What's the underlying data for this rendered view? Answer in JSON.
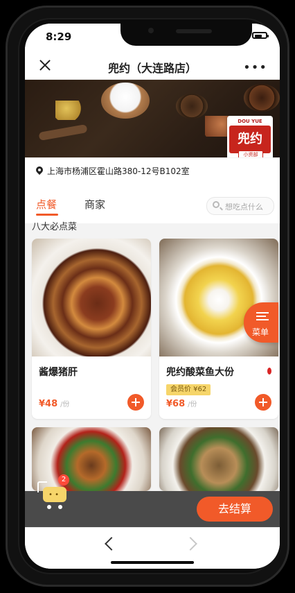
{
  "status": {
    "time": "8:29"
  },
  "nav": {
    "title": "兜约（大连路店）",
    "more": "•••"
  },
  "address": "上海市杨浦区霍山路380-12号B102室",
  "logo": {
    "top": "DOU YUE",
    "main": "兜约",
    "sub": "小资部"
  },
  "tabs": [
    {
      "label": "点餐",
      "active": true
    },
    {
      "label": "商家",
      "active": false
    }
  ],
  "search": {
    "placeholder": "想吃点什么"
  },
  "section": {
    "title": "八大必点菜"
  },
  "dishes": [
    {
      "name": "酱爆猪肝",
      "price": "¥48",
      "unit": "/份"
    },
    {
      "name": "兜约酸菜鱼大份",
      "price": "¥68",
      "unit": "/份",
      "member_price": "会员价 ¥62"
    }
  ],
  "menu_fab": {
    "label": "菜单"
  },
  "cart": {
    "count": "2"
  },
  "checkout": {
    "label": "去结算"
  },
  "colors": {
    "accent": "#f15a29",
    "member_bg": "#f6d56a"
  }
}
